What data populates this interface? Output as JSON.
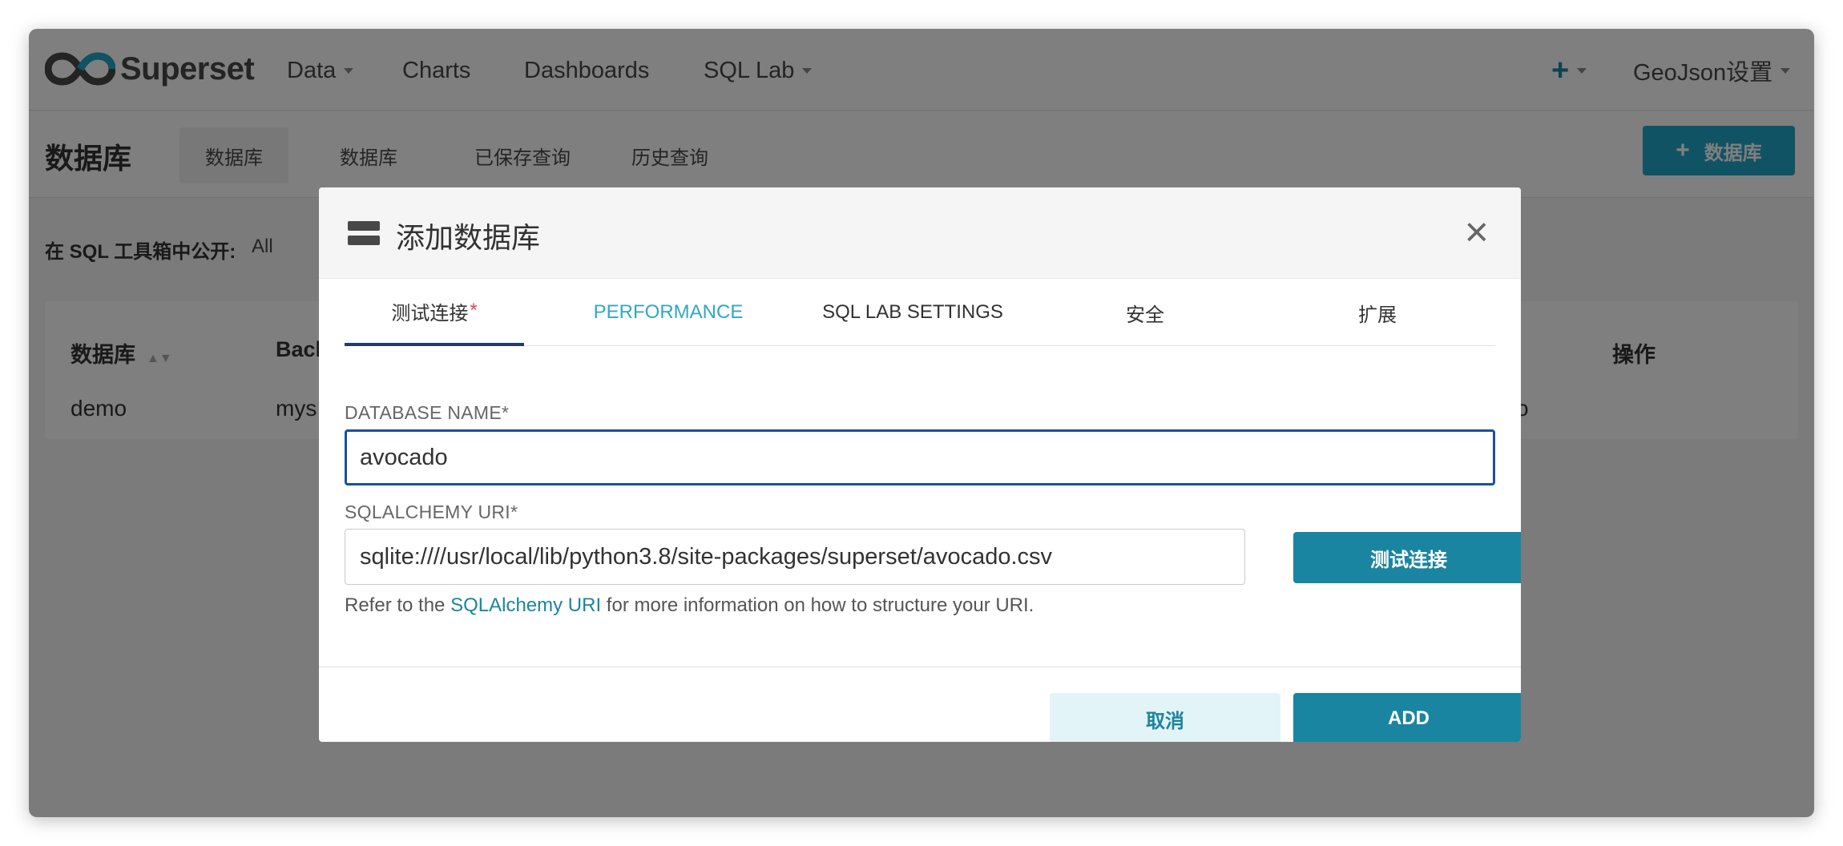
{
  "navbar": {
    "brand": "Superset",
    "items": [
      {
        "label": "Data",
        "has_caret": true
      },
      {
        "label": "Charts",
        "has_caret": false
      },
      {
        "label": "Dashboards",
        "has_caret": false
      },
      {
        "label": "SQL Lab",
        "has_caret": true
      }
    ],
    "plus_icon": "+",
    "user_menu": "GeoJson设置"
  },
  "subheader": {
    "title": "数据库",
    "tabs": [
      "数据库",
      "数据库",
      "已保存查询",
      "历史查询"
    ],
    "add_button": "数据库",
    "add_button_icon": "+"
  },
  "filter": {
    "label": "在 SQL 工具箱中公开:",
    "value": "All"
  },
  "table": {
    "headers": [
      "数据库",
      "Back",
      "操作"
    ],
    "rows": [
      {
        "name": "demo",
        "backend": "mys",
        "tail": "o"
      }
    ]
  },
  "modal": {
    "title": "添加数据库",
    "close_icon": "×",
    "tabs": [
      "测试连接",
      "PERFORMANCE",
      "SQL LAB SETTINGS",
      "安全",
      "扩展"
    ],
    "required_mark": "*",
    "database_name_label": "DATABASE NAME*",
    "database_name_value": "avocado",
    "uri_label": "SQLALCHEMY URI*",
    "uri_value": "sqlite:////usr/local/lib/python3.8/site-packages/superset/avocado.csv",
    "test_button": "测试连接",
    "helper_prefix": "Refer to the ",
    "helper_link": "SQLAlchemy URI",
    "helper_suffix": " for more information on how to structure your URI.",
    "cancel_button": "取消",
    "add_button": "ADD"
  },
  "colors": {
    "primary": "#1a85a0",
    "focus_border": "#1a4fa0",
    "required": "#e04355"
  }
}
